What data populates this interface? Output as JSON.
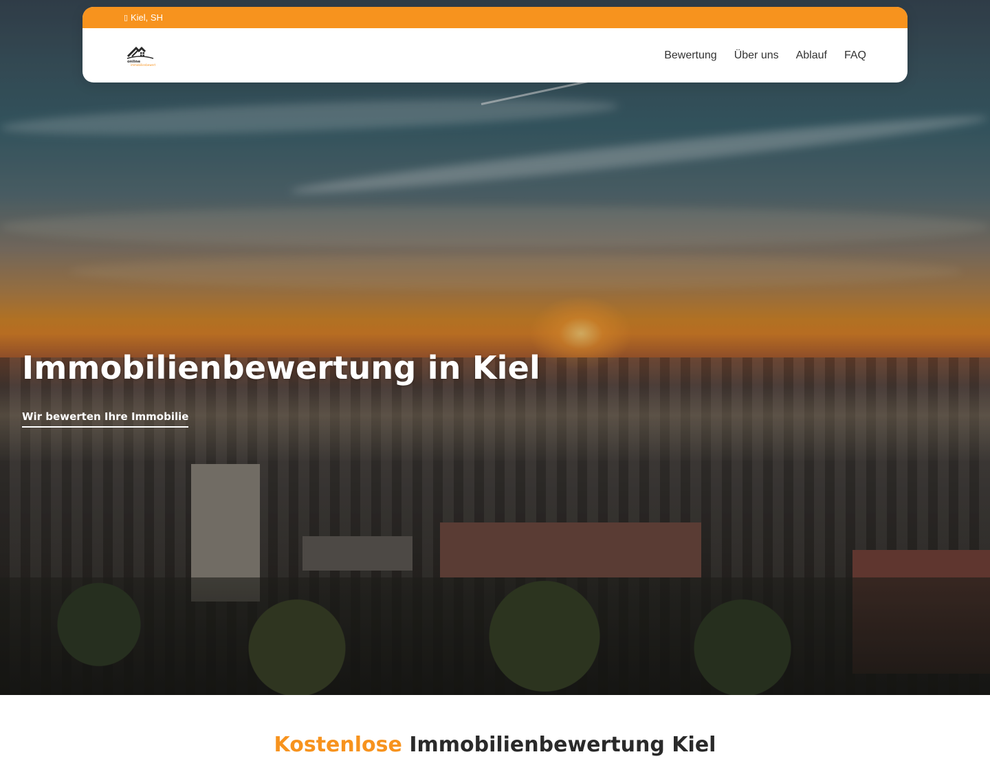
{
  "topbar": {
    "location_icon": "map-marker-icon",
    "location_text": "Kiel, SH",
    "background_color": "#f7931e"
  },
  "logo": {
    "name": "online-immobilienbewertung-logo",
    "wordmark_line1": "online",
    "wordmark_line2": "immobilienbewerter"
  },
  "nav": {
    "items": [
      {
        "label": "Bewertung"
      },
      {
        "label": "Über uns"
      },
      {
        "label": "Ablauf"
      },
      {
        "label": "FAQ"
      }
    ]
  },
  "hero": {
    "title": "Immobilienbewertung in Kiel",
    "cta_link": "Wir bewerten Ihre Immobilie",
    "background": "kiel-sunset-cityscape-photo"
  },
  "section": {
    "heading_accent": "Kostenlose",
    "heading_rest": "Immobilienbewertung Kiel",
    "accent_color": "#f7931e"
  }
}
